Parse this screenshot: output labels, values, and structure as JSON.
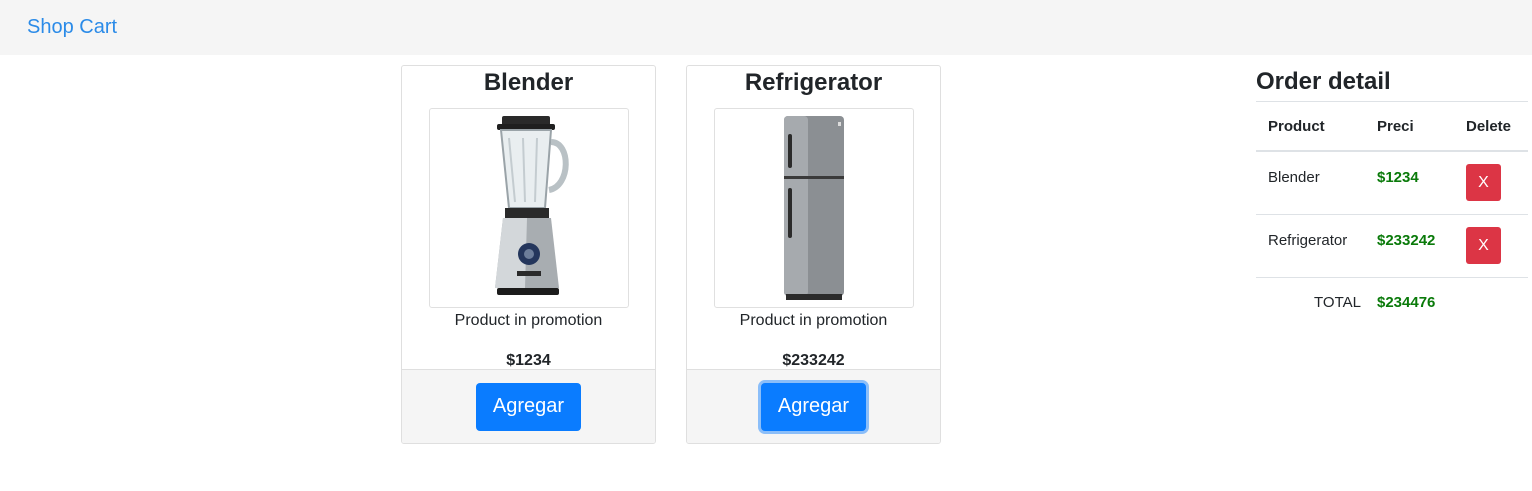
{
  "navbar": {
    "brand": "Shop Cart"
  },
  "products": [
    {
      "name": "Blender",
      "image_icon": "blender-image",
      "description": "Product in promotion",
      "price": "$1234",
      "button_label": "Agregar"
    },
    {
      "name": "Refrigerator",
      "image_icon": "refrigerator-image",
      "description": "Product in promotion",
      "price": "$233242",
      "button_label": "Agregar"
    }
  ],
  "order": {
    "title": "Order detail",
    "columns": [
      "Product",
      "Preci",
      "Delete"
    ],
    "rows": [
      {
        "product": "Blender",
        "price": "$1234",
        "delete_label": "X"
      },
      {
        "product": "Refrigerator",
        "price": "$233242",
        "delete_label": "X"
      }
    ],
    "total_label": "TOTAL",
    "total_value": "$234476"
  },
  "colors": {
    "primary": "#0a7cff",
    "danger": "#dc3545",
    "price": "#0a7a0a",
    "brand_link": "#2b8be8"
  }
}
